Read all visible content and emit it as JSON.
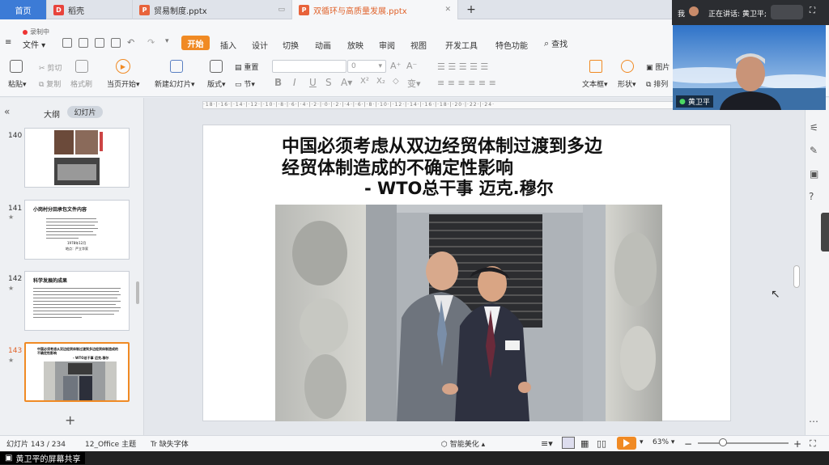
{
  "tabs": {
    "home": "首页",
    "t1": "稻壳",
    "t2": "贸易制度.pptx",
    "t3": "双循环与高质量发展.pptx",
    "add": "+"
  },
  "recording": "录制中",
  "menu": {
    "file": "文件",
    "start": "开始",
    "tabs": [
      "插入",
      "设计",
      "切换",
      "动画",
      "放映",
      "审阅",
      "视图",
      "开发工具",
      "特色功能"
    ],
    "find": "查找"
  },
  "ribbon": {
    "paste": "粘贴",
    "cut": "剪切",
    "copy": "复制",
    "format_painter": "格式刷",
    "from_current": "当页开始",
    "new_slide": "新建幻灯片",
    "layout": "版式",
    "reset": "重置",
    "section": "节",
    "font_size": "0",
    "textbox": "文本框",
    "shape": "形状",
    "picture": "图片",
    "arrange": "排列"
  },
  "left_panel": {
    "outline": "大纲",
    "slides": "幻灯片",
    "thumbs": [
      {
        "num": "140"
      },
      {
        "num": "141",
        "title": "小岗村分田承包文件内容",
        "date": "1978年12月",
        "place": "地点：严立华家"
      },
      {
        "num": "142",
        "title": "科学发展的成果"
      },
      {
        "num": "143",
        "title": "中国必须考虑从双边经贸体制过渡到多边经贸体制造成的不确定性影响",
        "sub": "- WTO总干事 迈克.穆尔"
      }
    ],
    "add": "+"
  },
  "slide": {
    "title_line1": "中国必须考虑从双边经贸体制过渡到多边",
    "title_line2": "经贸体制造成的不确定性影响",
    "attribution": "- WTO总干事 迈克.穆尔"
  },
  "status": {
    "slide_pos": "幻灯片 143 / 234",
    "theme": "12_Office 主题",
    "missing_font": "缺失字体",
    "smart": "智能美化",
    "zoom": "63%"
  },
  "share_bar": "黄卫平的屏幕共享",
  "video": {
    "me": "我",
    "speaking": "正在讲话: 黄卫平;",
    "name": "黄卫平"
  }
}
